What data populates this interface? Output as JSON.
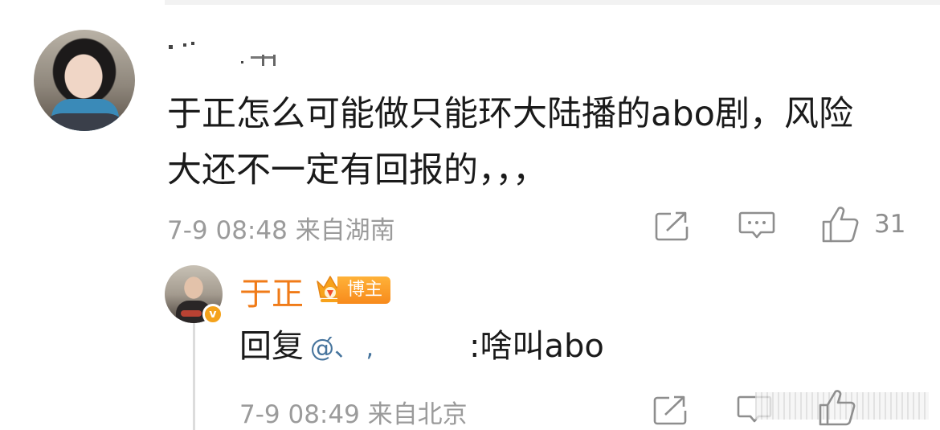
{
  "comment": {
    "text_line1": "于正怎么可能做只能环大陆播的abo剧，风险",
    "text_line2": "大还不一定有回报的，，，",
    "time": "7-9 08:48",
    "location": "来自湖南",
    "like_count": "31"
  },
  "reply": {
    "author": "于正",
    "badge_label": "博主",
    "verified_mark": "v",
    "prefix": "回复",
    "mention": "@́、 ,",
    "text": ":啥叫abo",
    "time": "7-9 08:49",
    "location": "来自北京"
  },
  "icons": {
    "share": "share-icon",
    "comment": "comment-icon",
    "like": "like-icon",
    "crown": "crown-badge-icon"
  },
  "colors": {
    "author_orange": "#f07b18",
    "mention_blue": "#46749d",
    "meta_gray": "#9b9b9b",
    "badge_orange": "#f78a1c",
    "verified_gold": "#f4a21b"
  }
}
